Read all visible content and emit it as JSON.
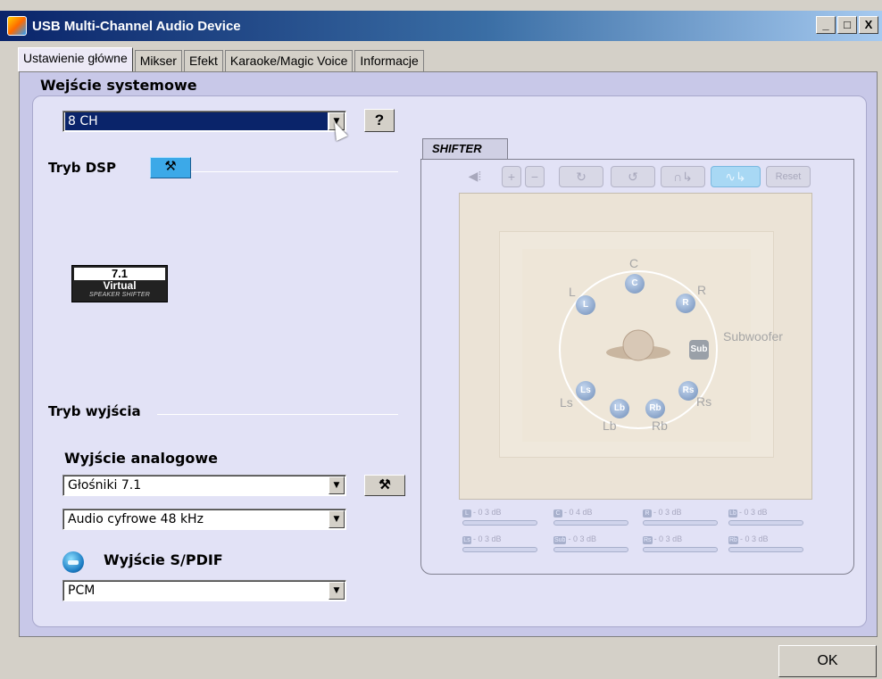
{
  "window": {
    "title": "USB Multi-Channel Audio Device",
    "controls": [
      "_",
      "□",
      "X"
    ]
  },
  "tabs": [
    {
      "label": "Ustawienie główne",
      "active": true
    },
    {
      "label": "Mikser",
      "active": false
    },
    {
      "label": "Efekt",
      "active": false
    },
    {
      "label": "Karaoke/Magic Voice",
      "active": false
    },
    {
      "label": "Informacje",
      "active": false
    }
  ],
  "system_input": {
    "title": "Wejście systemowe",
    "select_value": "8 CH",
    "help_label": "?"
  },
  "dsp": {
    "label": "Tryb DSP",
    "badge_top": "7.1",
    "badge_mid": "Virtual",
    "badge_bottom": "SPEAKER SHIFTER"
  },
  "output": {
    "label": "Tryb wyjścia",
    "analog_label": "Wyjście analogowe",
    "analog_value": "Głośniki 7.1",
    "digital_value": "Audio cyfrowe 48 kHz",
    "spdif_label": "Wyjście S/PDIF",
    "spdif_value": "PCM"
  },
  "shifter": {
    "tab_label": "SHIFTER",
    "reset_label": "Reset",
    "speakers": {
      "c": "C",
      "l": "L",
      "r": "R",
      "ls": "Ls",
      "rs": "Rs",
      "lb": "Lb",
      "rb": "Rb",
      "sub": "Sub",
      "subwoofer": "Subwoofer"
    },
    "meters": [
      {
        "chip": "L",
        "text": "- 0 3 dB"
      },
      {
        "chip": "C",
        "text": "- 0 4 dB"
      },
      {
        "chip": "R",
        "text": "- 0 3 dB"
      },
      {
        "chip": "Lb",
        "text": "- 0 3 dB"
      },
      {
        "chip": "Ls",
        "text": "- 0 3 dB"
      },
      {
        "chip": "Sub",
        "text": "- 0 3 dB"
      },
      {
        "chip": "Rs",
        "text": "- 0 3 dB"
      },
      {
        "chip": "Rb",
        "text": "- 0 3 dB"
      }
    ]
  },
  "footer": {
    "ok_label": "OK"
  }
}
